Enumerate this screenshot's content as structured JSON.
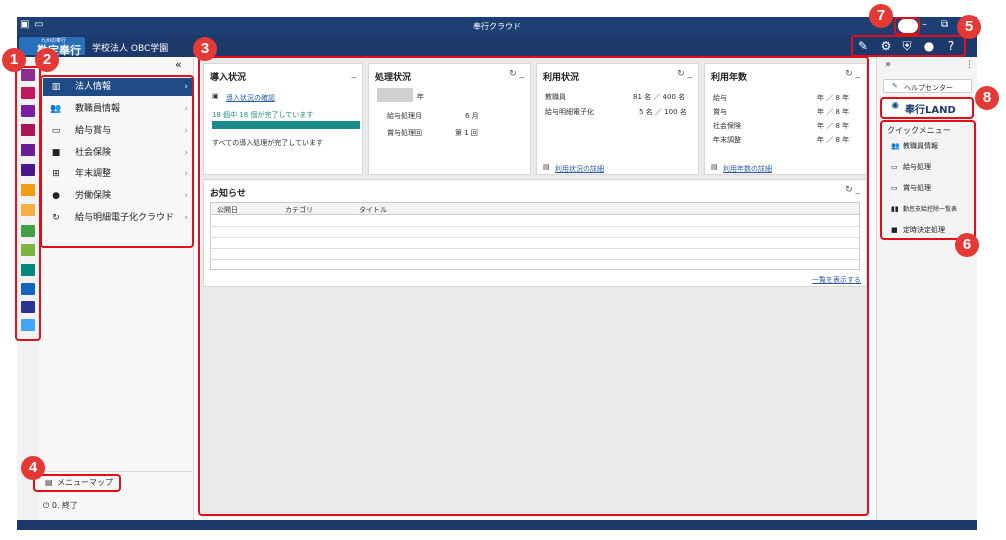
{
  "window": {
    "title": "奉行クラウド"
  },
  "header": {
    "logo_text": "勘定奉行",
    "logo_sub": "九州の奉行",
    "company": "学校法人 OBC学園"
  },
  "sidebar": {
    "collapse": "«",
    "items": [
      {
        "label": "法人情報",
        "icon": "building-icon",
        "active": true
      },
      {
        "label": "教職員情報",
        "icon": "people-icon"
      },
      {
        "label": "給与賞与",
        "icon": "money-icon"
      },
      {
        "label": "社会保険",
        "icon": "briefcase-icon"
      },
      {
        "label": "年末調整",
        "icon": "grid-icon"
      },
      {
        "label": "労働保険",
        "icon": "person-icon"
      },
      {
        "label": "給与明細電子化クラウド",
        "icon": "refresh-icon"
      }
    ],
    "menu_map": "メニューマップ",
    "exit": "0. 終了"
  },
  "cards": {
    "intro": {
      "title": "導入状況",
      "link": "導入状況の確認",
      "progress_text": "18 個中 18 個が完了しています",
      "progress": 1.0,
      "done_text": "すべての導入処理が完了しています"
    },
    "processing": {
      "title": "処理状況",
      "year_suffix": "年",
      "rows": [
        {
          "label": "給与処理月",
          "value": "6 月"
        },
        {
          "label": "賞与処理回",
          "value": "第 1 回"
        }
      ]
    },
    "usage": {
      "title": "利用状況",
      "rows": [
        {
          "label": "教職員",
          "value": "81 名 ／ 400 名"
        },
        {
          "label": "給与明細電子化",
          "value": "5 名 ／ 100 名"
        }
      ],
      "link": "利用状況の詳細"
    },
    "years": {
      "title": "利用年数",
      "rows": [
        {
          "label": "給与",
          "value": "年 ／ 8 年"
        },
        {
          "label": "賞与",
          "value": "年 ／ 8 年"
        },
        {
          "label": "社会保険",
          "value": "年 ／ 8 年"
        },
        {
          "label": "年末調整",
          "value": "年 ／ 8 年"
        }
      ],
      "link": "利用年数の詳細"
    },
    "news": {
      "title": "お知らせ",
      "columns": [
        "公開日",
        "カテゴリ",
        "タイトル"
      ],
      "show_all": "一覧を表示する"
    }
  },
  "rightpanel": {
    "expand": "»",
    "more": "⋮",
    "help_center": "ヘルプセンター",
    "land": "奉行LAND",
    "quick_menu_title": "クイックメニュー",
    "quick_items": [
      {
        "label": "教職員情報",
        "icon": "people-icon"
      },
      {
        "label": "給与処理",
        "icon": "money-icon"
      },
      {
        "label": "賞与処理",
        "icon": "money-icon"
      },
      {
        "label": "勤怠支給控除一覧表",
        "icon": "books-icon"
      },
      {
        "label": "定時決定処理",
        "icon": "briefcase-icon"
      }
    ]
  },
  "annotations": [
    "1",
    "2",
    "3",
    "4",
    "5",
    "6",
    "7",
    "8"
  ],
  "colors": {
    "header": "#1b3a6b",
    "accent": "#1f4b85",
    "progress": "#1a8a8a",
    "annotation": "#e53935"
  }
}
